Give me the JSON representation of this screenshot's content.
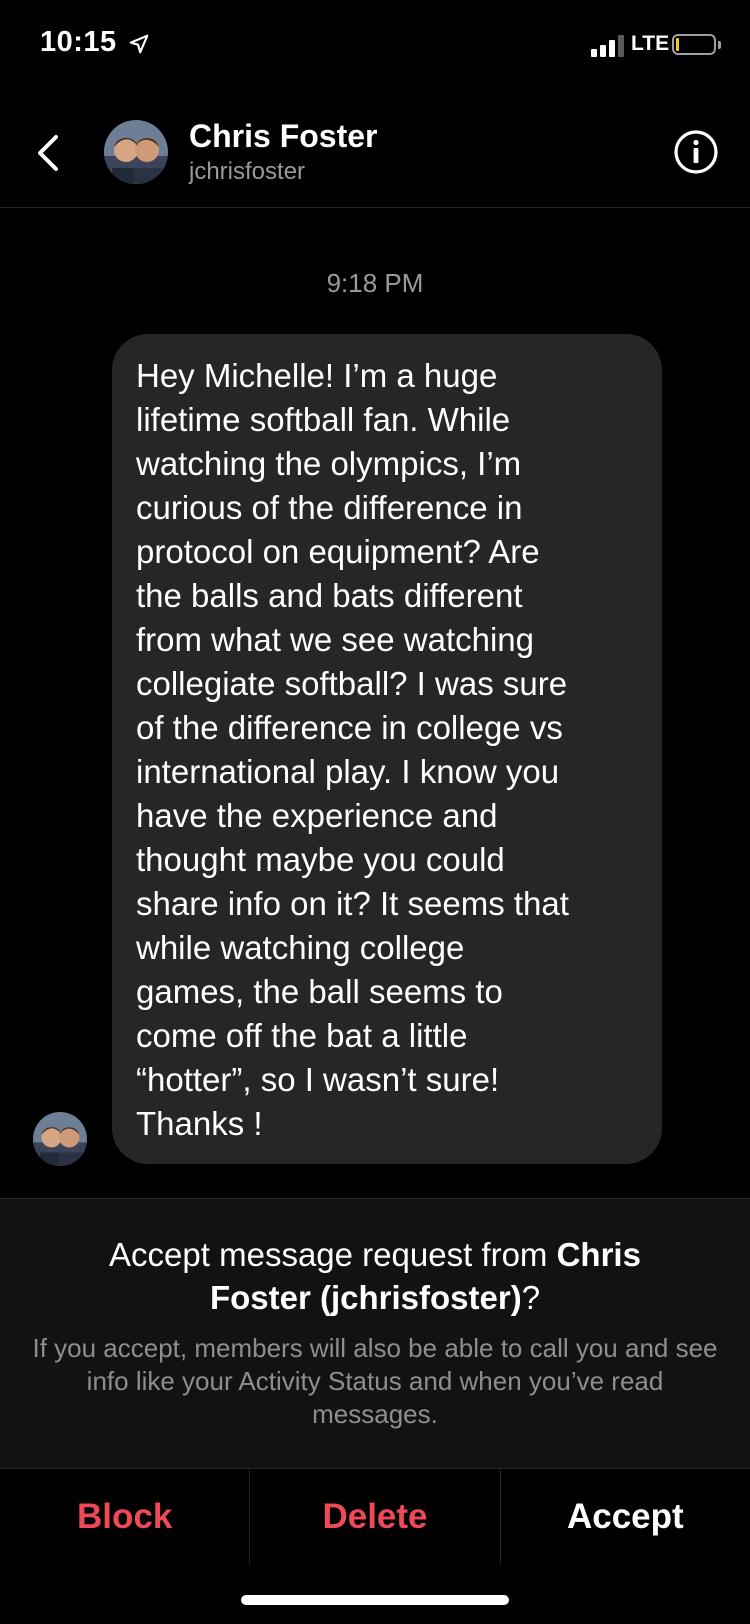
{
  "status_bar": {
    "time": "10:15",
    "network": "LTE",
    "battery_color": "#f3c631"
  },
  "header": {
    "name": "Chris Foster",
    "username": "jchrisfoster",
    "icons": {
      "back": "chevron-left-icon",
      "info": "info-circle-icon"
    }
  },
  "conversation": {
    "timestamp": "9:18 PM",
    "message": "Hey Michelle! I’m a huge\nlifetime softball fan. While\nwatching the olympics, I’m\ncurious of the difference in\nprotocol on equipment? Are\nthe balls and bats different\nfrom what we see watching\ncollegiate softball? I was sure\nof the difference in college vs\ninternational play. I know you\nhave the experience and\nthought maybe you could\nshare info on it? It seems that\nwhile watching college\ngames, the ball seems to\ncome off the bat a little\n“hotter”, so I wasn’t sure!\nThanks !"
  },
  "request": {
    "title_prefix": "Accept message request from ",
    "title_name": "Chris Foster (jchrisfoster)",
    "title_suffix": "?",
    "description": "If you accept, members will also be able to call you and see info like your Activity Status and when you’ve read messages."
  },
  "actions": {
    "block": "Block",
    "delete": "Delete",
    "accept": "Accept"
  },
  "colors": {
    "destructive": "#ed4956",
    "background": "#000000",
    "bubble": "#262626"
  }
}
